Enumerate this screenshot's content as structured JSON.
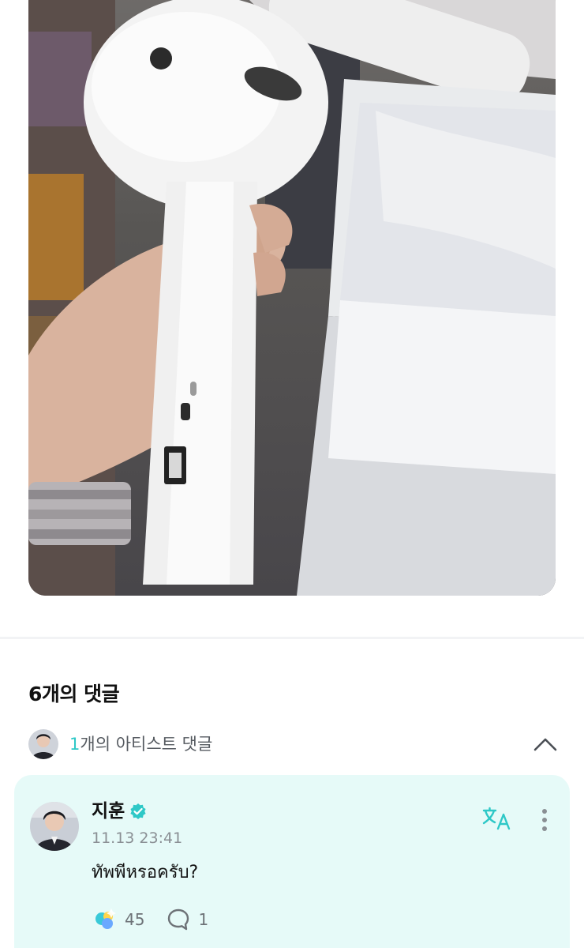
{
  "comments": {
    "title": "6개의 댓글",
    "artist_section": {
      "count": "1",
      "label": "개의 아티스트 댓글"
    }
  },
  "artist_comment": {
    "author": "지훈",
    "timestamp": "11.13 23:41",
    "text": "ทัพพีหรอครับ?",
    "likes": "45",
    "replies": "1"
  },
  "icons": {
    "collapse": "chevron-up-icon",
    "verified": "verified-badge-icon",
    "translate": "translate-icon",
    "more": "more-vertical-icon",
    "like": "like-reaction-icon",
    "reply": "reply-bubble-icon"
  },
  "colors": {
    "accent": "#2ec8c7",
    "card_background": "#e6faf8",
    "muted_text": "#8a8f94"
  }
}
